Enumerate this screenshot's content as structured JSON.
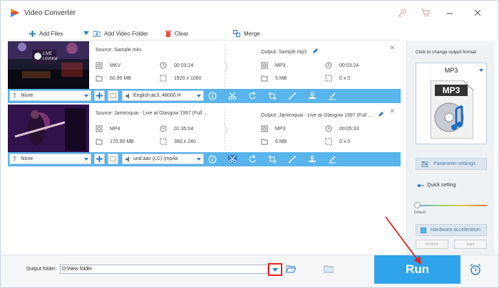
{
  "window": {
    "title": "Video Converter"
  },
  "toolbar": {
    "add_files": "Add Files",
    "add_video_folder": "Add Video Folder",
    "clear": "Clear",
    "merge": "Merge"
  },
  "files": [
    {
      "source": "Source: Sample.mkv",
      "output": "Output: Sample.mp3",
      "src_format": "MKV",
      "src_duration": "00:03:24",
      "src_size": "60.95 MB",
      "src_resolution": "1920 x 1080",
      "out_format": "MP3",
      "out_duration": "00:03:24",
      "out_size": "5 MB",
      "out_resolution": "0 x 0",
      "subtitle": "None",
      "audio": "English ac3, 48000 H"
    },
    {
      "source": "Source: Jamiroquai - Live at Glasgow 1997 (Full ...",
      "output": "Output: Jamiroquai - Live at Glasgow 1997 (Full ...",
      "src_format": "MP4",
      "src_duration": "01:35:04",
      "src_size": "170.90 MB",
      "src_resolution": "360 x 240",
      "out_format": "MP3",
      "out_duration": "00:05:33",
      "out_size": "6 MB",
      "out_resolution": "0 x 0",
      "subtitle": "None",
      "audio": "und aac (LC) (mp4a"
    }
  ],
  "right_panel": {
    "hint": "Click to change output format:",
    "format": "MP3",
    "format_icon_text": "MP3",
    "parameter_settings": "Parameter settings",
    "quick_setting": "Quick setting",
    "slider_default": "Default",
    "hardware_acceleration": "Hardware acceleration",
    "nvidia": "NVIDIA",
    "intel": "Intel"
  },
  "bottom": {
    "output_folder_label": "Output folder:",
    "output_folder_value": "D:\\New folder",
    "run": "Run"
  },
  "colors": {
    "accent": "#5ab4ec",
    "run": "#2fa3ec",
    "highlight": "#e22020"
  }
}
